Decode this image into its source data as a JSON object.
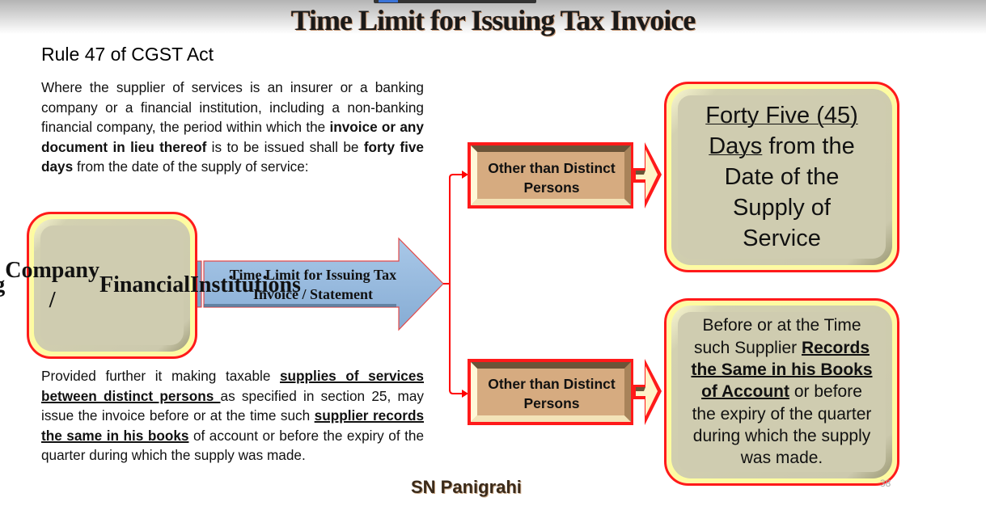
{
  "slide": {
    "title": "Time Limit for Issuing Tax Invoice",
    "subtitle": "Rule 47  of CGST Act",
    "paragraph1": {
      "parts": [
        {
          "text": "Where the supplier of services is an insurer or a banking company or a financial institution, including a non-banking financial company, the period within which the ",
          "style": "normal"
        },
        {
          "text": "invoice or any document in lieu thereof",
          "style": "bold"
        },
        {
          "text": " is to be issued shall be ",
          "style": "normal"
        },
        {
          "text": "forty five days",
          "style": "bold"
        },
        {
          "text": " from the date of the supply of service:",
          "style": "normal"
        }
      ]
    },
    "paragraph2": {
      "parts": [
        {
          "text": "Provided further it making taxable ",
          "style": "normal"
        },
        {
          "text": "supplies of services between distinct persons ",
          "style": "bold-underline"
        },
        {
          "text": "as specified in section 25, may issue the invoice before or at the time such ",
          "style": "normal"
        },
        {
          "text": "supplier records the same in his books",
          "style": "bold-underline"
        },
        {
          "text": " of account or before the expiry of the quarter during which the supply was made.",
          "style": "normal"
        }
      ]
    },
    "footer_author": "SN Panigrahi",
    "page_number": "38"
  },
  "diagram": {
    "source_box": {
      "lines": [
        "Banking",
        "Company /",
        "Financial",
        "Institutions"
      ]
    },
    "main_arrow": {
      "lines": [
        "Time Limit for Issuing Tax",
        "Invoice / Statement"
      ]
    },
    "branch_top": {
      "lines": [
        "Other than Distinct",
        "Persons"
      ]
    },
    "branch_bottom": {
      "lines": [
        "Other than Distinct",
        "Persons"
      ]
    },
    "result_top": {
      "parts": [
        {
          "text": "Forty Five (45)",
          "style": "underline"
        },
        {
          "text": "\n",
          "style": "break"
        },
        {
          "text": "Days",
          "style": "underline"
        },
        {
          "text": " from the",
          "style": "normal"
        },
        {
          "text": "\n",
          "style": "break"
        },
        {
          "text": "Date of the",
          "style": "normal"
        },
        {
          "text": "\n",
          "style": "break"
        },
        {
          "text": "Supply of",
          "style": "normal"
        },
        {
          "text": "\n",
          "style": "break"
        },
        {
          "text": "Service",
          "style": "normal"
        }
      ]
    },
    "result_bottom": {
      "parts": [
        {
          "text": "Before or at the Time",
          "style": "normal"
        },
        {
          "text": "\n",
          "style": "break"
        },
        {
          "text": "such Supplier ",
          "style": "normal"
        },
        {
          "text": "Records",
          "style": "bold-underline"
        },
        {
          "text": "\n",
          "style": "break"
        },
        {
          "text": "the Same in his Books",
          "style": "bold-underline"
        },
        {
          "text": "\n",
          "style": "break"
        },
        {
          "text": "of Account",
          "style": "bold-underline"
        },
        {
          "text": " or before",
          "style": "normal"
        },
        {
          "text": "\n",
          "style": "break"
        },
        {
          "text": "the expiry of the quarter",
          "style": "normal"
        },
        {
          "text": "\n",
          "style": "break"
        },
        {
          "text": "during which the supply",
          "style": "normal"
        },
        {
          "text": "\n",
          "style": "break"
        },
        {
          "text": "was made.",
          "style": "normal"
        }
      ]
    },
    "colors": {
      "connector": "#ff0000",
      "box_border": "#ff1a1a",
      "box_face": "#cfccb0",
      "arrow_fill": "#8fb6dd",
      "branch_fill": "#d6ab80"
    }
  }
}
